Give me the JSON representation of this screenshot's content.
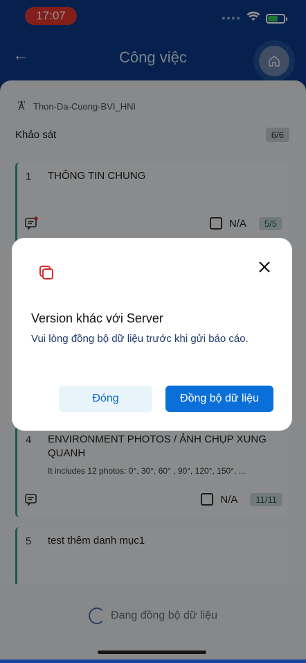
{
  "status_bar": {
    "time": "17:07",
    "battery_level": 0.6
  },
  "header": {
    "title": "Công việc",
    "back_icon": "arrow-left-icon",
    "home_icon": "home-icon"
  },
  "site": {
    "name": "Thon-Da-Cuong-BVI_HNI",
    "icon": "antenna-tower-icon"
  },
  "survey": {
    "label": "Khảo sát",
    "count": "6/6"
  },
  "cards": [
    {
      "number": "1",
      "title": "THÔNG TIN CHUNG",
      "na_label": "N/A",
      "progress": "5/5",
      "has_notification": true
    },
    {
      "number": "4",
      "title": "ENVIRONMENT PHOTOS / ẢNH CHỤP XUNG QUANH",
      "description": "It includes 12 photos: 0°, 30°, 60° , 90°, 120°, 150°, ...",
      "na_label": "N/A",
      "progress": "11/11"
    },
    {
      "number": "5",
      "title": "test thêm danh mục1"
    }
  ],
  "modal": {
    "title": "Version khác với Server",
    "message": "Vui lòng đồng bộ dữ liệu trước khi gửi báo cáo.",
    "close_button": "Đóng",
    "sync_button": "Đồng bộ dữ liệu",
    "icon": "copy-icon",
    "accent_color": "#d32f2f",
    "primary_color": "#0b6fd9"
  },
  "bottom": {
    "sync_status": "Đang đồng bộ dữ liệu"
  }
}
